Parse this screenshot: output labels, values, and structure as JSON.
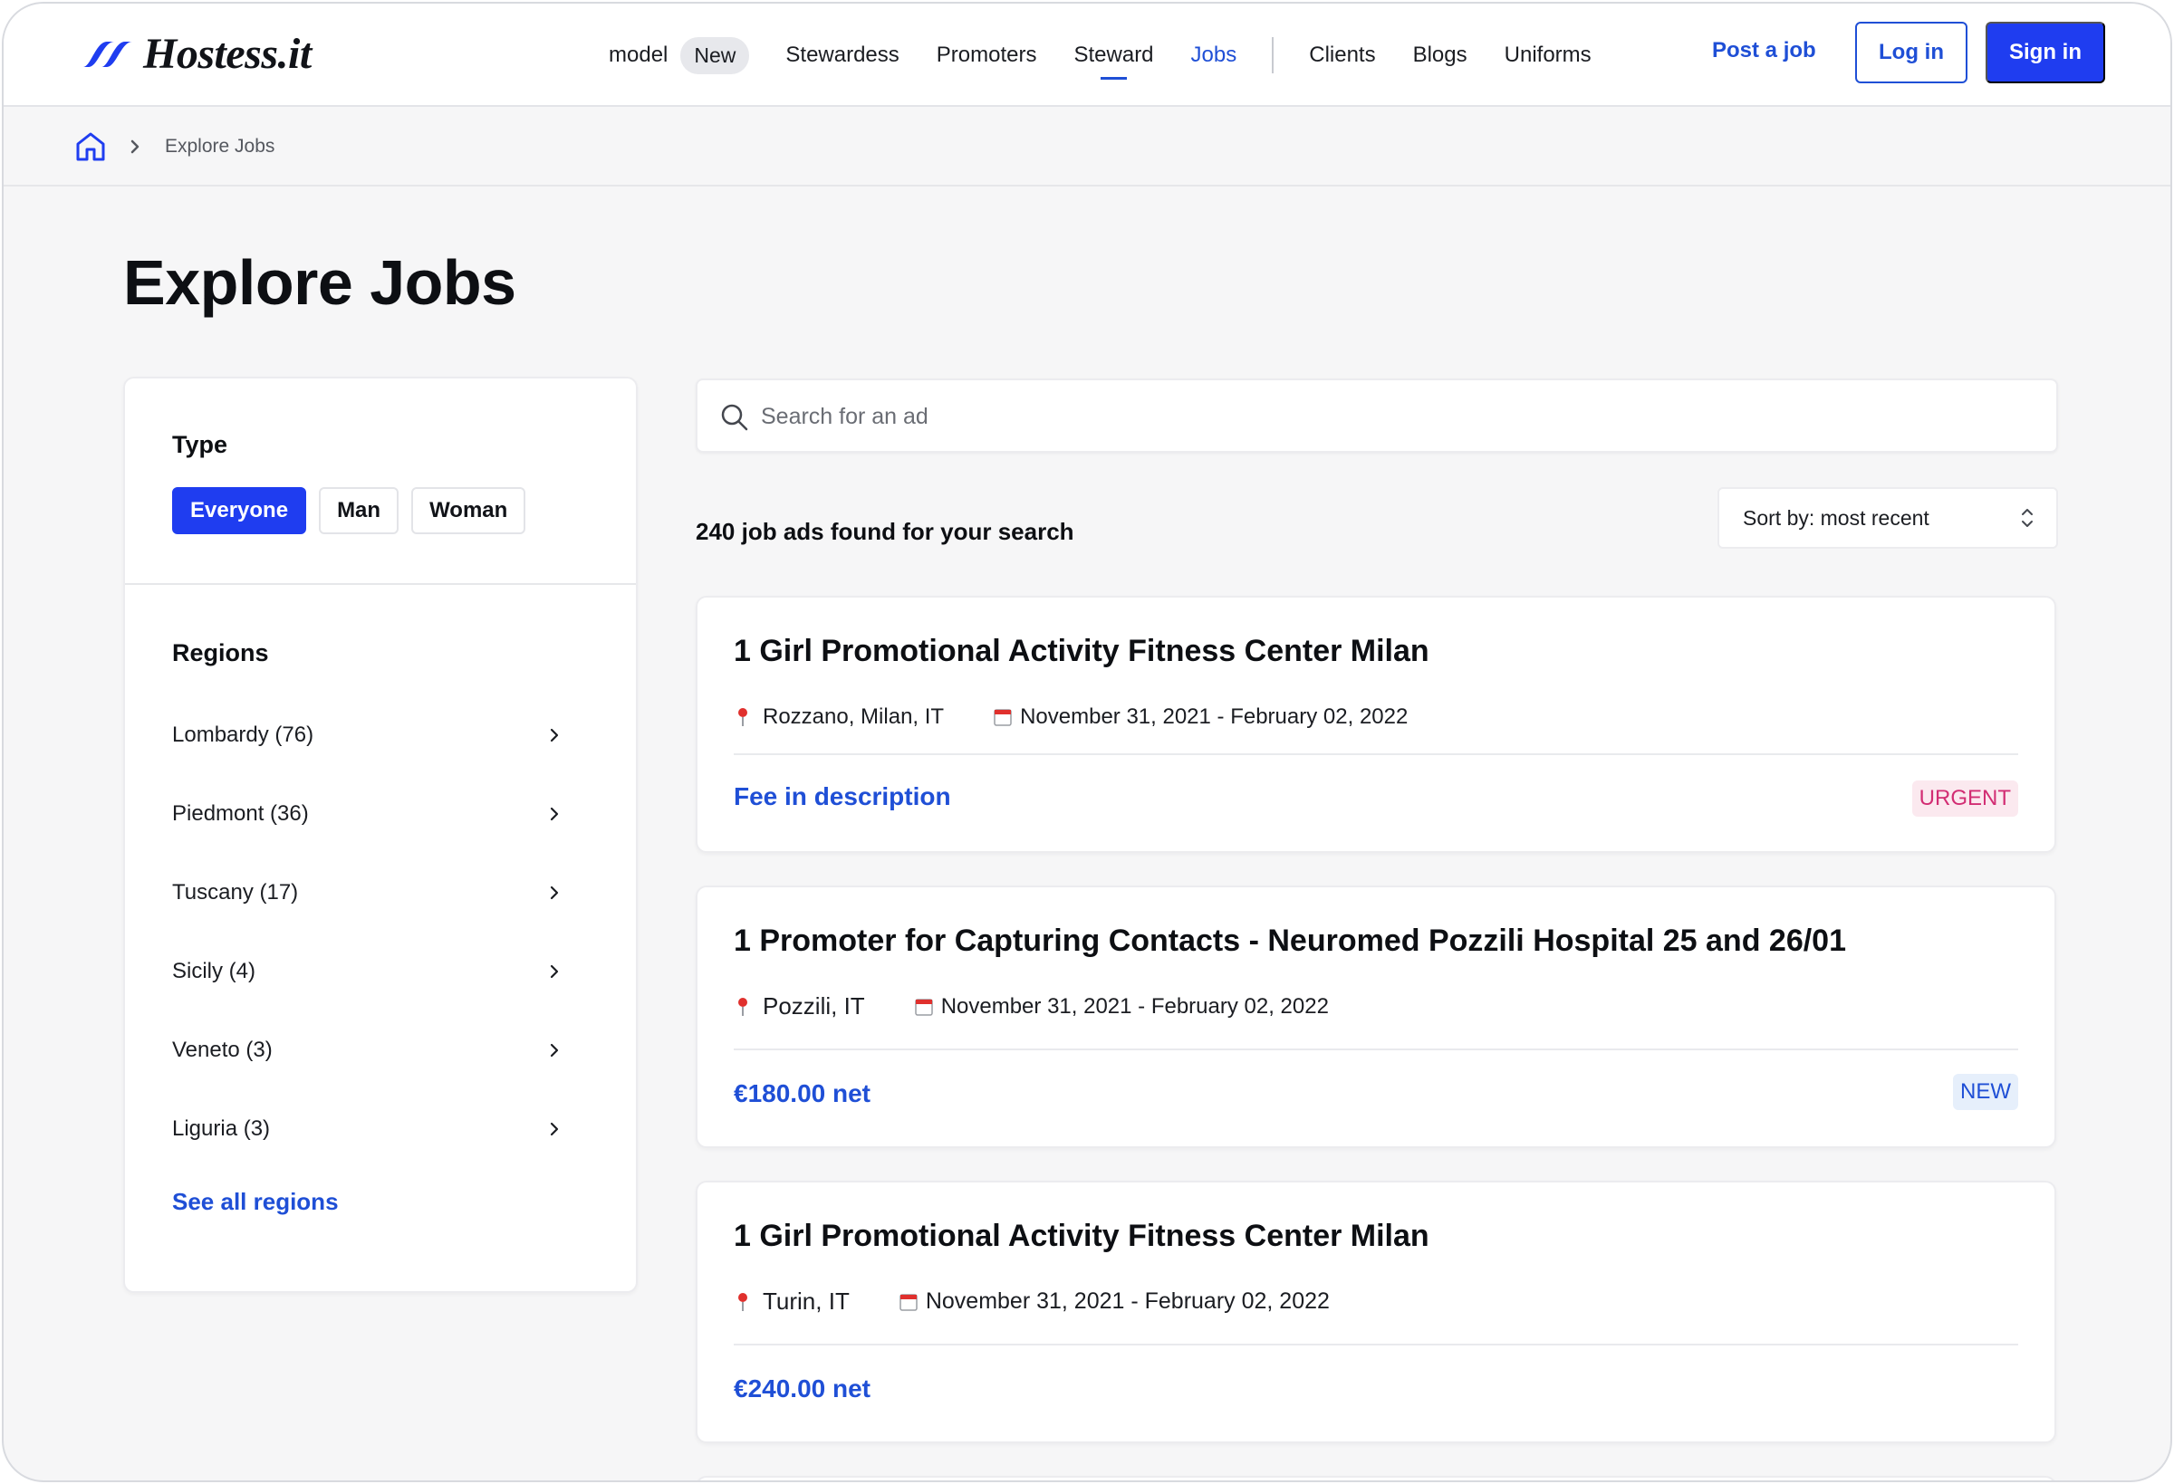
{
  "brand": {
    "name": "Hostess.it",
    "color": "#1f3df0"
  },
  "nav": {
    "items": [
      {
        "label": "model",
        "badge": "New"
      },
      {
        "label": "Stewardess"
      },
      {
        "label": "Promoters"
      },
      {
        "label": "Steward"
      },
      {
        "label": "Jobs"
      },
      {
        "label": "Clients"
      },
      {
        "label": "Blogs"
      },
      {
        "label": "Uniforms"
      }
    ],
    "active": "Jobs",
    "post_job": "Post a job",
    "login": "Log in",
    "signin": "Sign in"
  },
  "breadcrumb": {
    "home_icon": "home-icon",
    "current": "Explore Jobs"
  },
  "page_title": "Explore Jobs",
  "filters": {
    "type_heading": "Type",
    "types": [
      "Everyone",
      "Man",
      "Woman"
    ],
    "selected_type": "Everyone",
    "regions_heading": "Regions",
    "regions": [
      "Lombardy (76)",
      "Piedmont (36)",
      "Tuscany (17)",
      "Sicily (4)",
      "Veneto (3)",
      "Liguria (3)"
    ],
    "see_all": "See all regions"
  },
  "search": {
    "placeholder": "Search for an ad",
    "icon": "search-icon"
  },
  "results": {
    "count_text": "240 job ads found for your search",
    "sort_label": "Sort by: most recent"
  },
  "jobs": [
    {
      "title": "1 Girl Promotional Activity Fitness Center Milan",
      "location": "Rozzano, Milan, IT",
      "dates": "November 31, 2021 - February 02, 2022",
      "fee": "Fee in description",
      "tag": "URGENT"
    },
    {
      "title": "1 Promoter for Capturing Contacts - Neuromed Pozzili Hospital 25 and 26/01",
      "location": "Pozzili, IT",
      "dates": "November 31, 2021 - February 02, 2022",
      "fee": "€180.00 net",
      "tag": "NEW"
    },
    {
      "title": "1 Girl Promotional Activity Fitness Center Milan",
      "location": "Turin, IT",
      "dates": "November 31, 2021 - February 02, 2022",
      "fee": "€240.00 net",
      "tag": ""
    }
  ],
  "colors": {
    "accent": "#1f4fd6",
    "urgent": "#d22d73",
    "new": "#1f4fd6"
  }
}
